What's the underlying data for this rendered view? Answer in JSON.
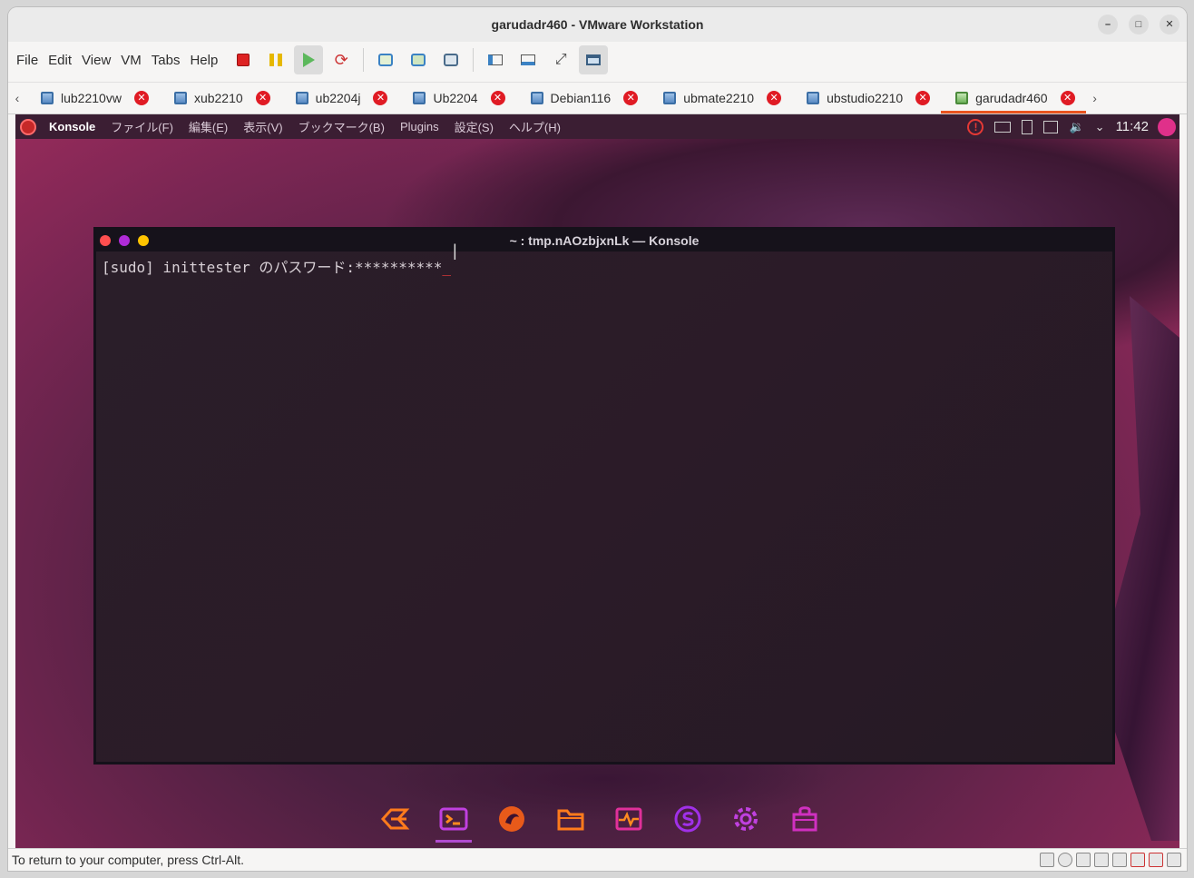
{
  "window": {
    "title": "garudadr460 - VMware Workstation"
  },
  "menubar": {
    "items": [
      "File",
      "Edit",
      "View",
      "VM",
      "Tabs",
      "Help"
    ]
  },
  "tabs": [
    {
      "label": "lub2210vw"
    },
    {
      "label": "xub2210"
    },
    {
      "label": "ub2204j"
    },
    {
      "label": "Ub2204"
    },
    {
      "label": "Debian116"
    },
    {
      "label": "ubmate2210"
    },
    {
      "label": "ubstudio2210"
    },
    {
      "label": "garudadr460",
      "active": true
    }
  ],
  "guest_panel": {
    "app_name": "Konsole",
    "menus": [
      "ファイル(F)",
      "編集(E)",
      "表示(V)",
      "ブックマーク(B)",
      "Plugins",
      "設定(S)",
      "ヘルプ(H)"
    ],
    "clock": "11:42"
  },
  "konsole": {
    "title": "~ : tmp.nAOzbjxnLk — Konsole",
    "prompt_line": "[sudo] inittester のパスワード:**********"
  },
  "dock": {
    "items": [
      "garuda-launcher-icon",
      "terminal-icon",
      "garuda-dragon-icon",
      "file-manager-icon",
      "system-monitor-icon",
      "store-icon",
      "settings-icon",
      "package-manager-icon"
    ]
  },
  "statusbar": {
    "text": "To return to your computer, press Ctrl-Alt."
  },
  "colors": {
    "accent_tab": "#e95420",
    "tab_close": "#e01b24",
    "dock_accent": "#b04bd0"
  }
}
